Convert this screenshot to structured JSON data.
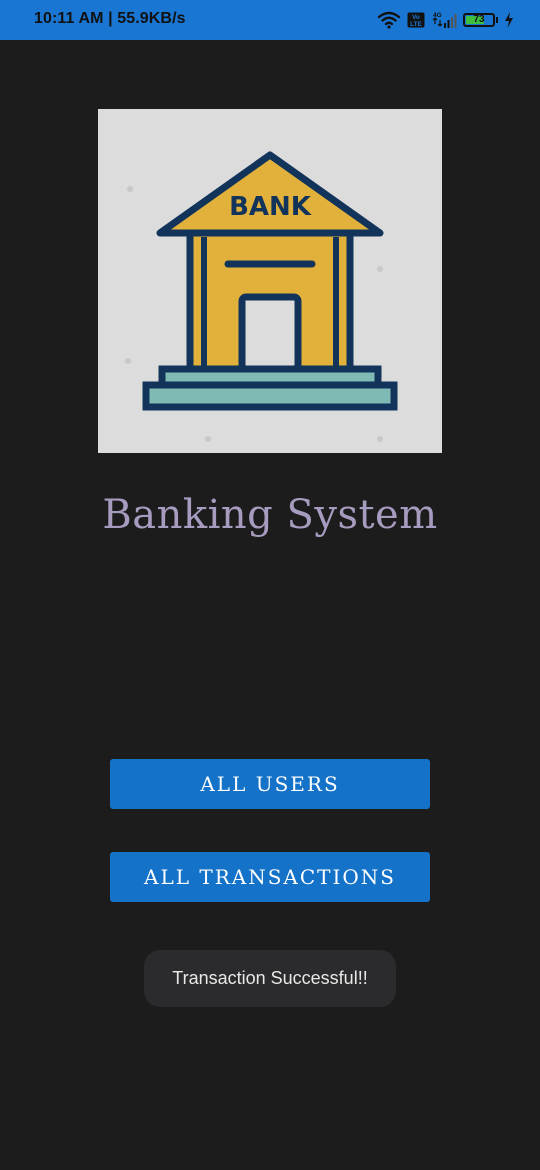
{
  "status_bar": {
    "time_speed": "10:11 AM | 55.9KB/s",
    "network_type": "4G",
    "volte": "Vo LTE",
    "battery_level": "73",
    "battery_fraction": 0.73,
    "icons": [
      "wifi-icon",
      "volte-icon",
      "signal-icon",
      "battery-icon",
      "charging-icon"
    ],
    "color": "#1976d2"
  },
  "logo": {
    "text": "BANK",
    "colors": {
      "background": "#dcdcdc",
      "building": "#e1b13c",
      "outline": "#12345a",
      "steps": "#7fbab4"
    }
  },
  "app_title": "Banking System",
  "buttons": {
    "all_users": "ALL USERS",
    "all_transactions": "ALL TRANSACTIONS",
    "color": "#1472c9"
  },
  "toast": {
    "message": "Transaction Successful!!"
  },
  "theme": {
    "background": "#1c1c1c",
    "title_color": "#a79bbf"
  }
}
